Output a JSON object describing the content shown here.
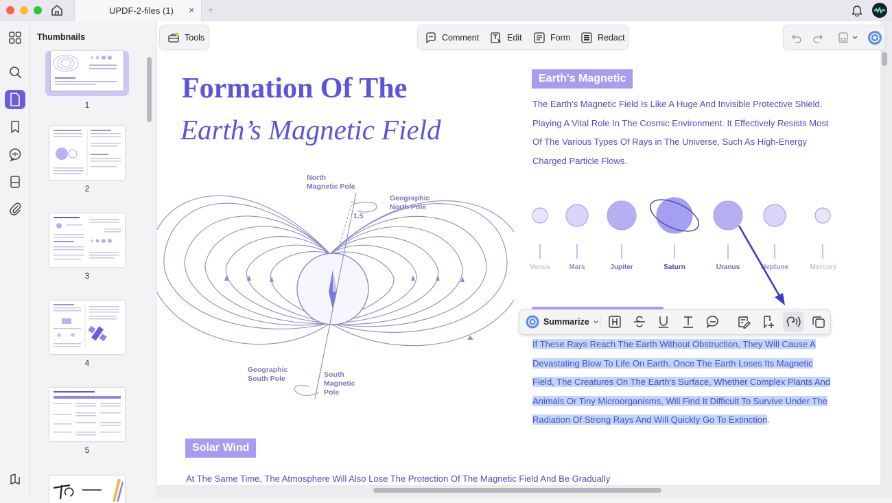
{
  "window": {
    "tab_title": "UPDF-2-files (1)",
    "tab_close": "×",
    "tab_add": "+"
  },
  "thumbnails": {
    "title": "Thumbnails",
    "pages": [
      "1",
      "2",
      "3",
      "4",
      "5"
    ]
  },
  "toolbar": {
    "tools_label": "Tools",
    "comment_label": "Comment",
    "edit_label": "Edit",
    "form_label": "Form",
    "redact_label": "Redact"
  },
  "document": {
    "title_line1": "Formation Of The",
    "title_line2": "Earth’s Magnetic Field",
    "section_magnetic": "Earth's Magnetic",
    "para1": [
      "The Earth's Magnetic Field Is Like A Huge And Invisible Protective Shield,",
      "Playing A Vital Role In The Cosmic Environment. It Effectively Resists Most",
      "Of The Various Types Of Rays in The Universe, Such As High-Energy",
      "Charged Particle Flows."
    ],
    "para2": [
      "If These Rays Reach The Earth Without Obstruction, They Will Cause A",
      "Devastating Blow To Life On Earth. Once The Earth Loses Its Magnetic",
      "Field, The Creatures On The Earth's Surface, Whether Complex Plants And",
      "Animals Or Tiny Microorganisms, Will Find It Difficult To Survive Under The",
      "Radiation Of Strong Rays And Will Quickly Go To Extinction"
    ],
    "para2_end": ".",
    "section_solar": "Solar Wind",
    "para3": "At The Same Time, The Atmosphere Will Also Lose The Protection Of The Magnetic Field And Be Gradually",
    "planets": [
      "Venus",
      "Mars",
      "Jupiter",
      "Saturn",
      "Uranus",
      "Neptune",
      "Mercury"
    ],
    "diagram": {
      "north_magnetic": [
        "North",
        "Magnetic Pole"
      ],
      "geo_north": [
        "Geographic",
        "North Pole"
      ],
      "angle": "1.5",
      "geo_south": [
        "Geographic",
        "South Pole"
      ],
      "south_magnetic": [
        "South",
        "Magnetic",
        "Pole"
      ]
    }
  },
  "selection_toolbar": {
    "summarize_label": "Summarize"
  },
  "colors": {
    "accent": "#6a5bdf",
    "heading": "#5b55d8",
    "body_text": "#4b4cc7",
    "tag_bg": "#a79cf2",
    "highlight": "#c1d6fb"
  }
}
